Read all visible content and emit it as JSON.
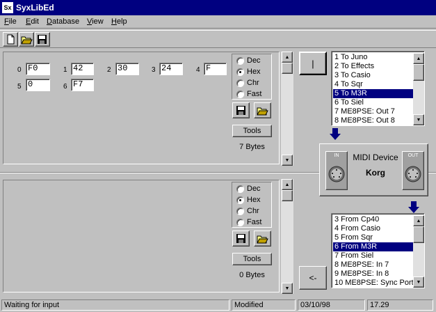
{
  "app": {
    "title": "SyxLibEd",
    "icon_text": "Sx"
  },
  "menu": [
    {
      "label": "File",
      "key": "F",
      "rest": "ile"
    },
    {
      "label": "Edit",
      "key": "E",
      "rest": "dit"
    },
    {
      "label": "Database",
      "key": "D",
      "rest": "atabase"
    },
    {
      "label": "View",
      "key": "V",
      "rest": "iew"
    },
    {
      "label": "Help",
      "key": "H",
      "rest": "elp"
    }
  ],
  "toolbar": {
    "icons": [
      "new-file-icon",
      "open-folder-icon",
      "save-disk-icon"
    ]
  },
  "top_pane": {
    "bytes": [
      {
        "index": "0",
        "value": "F0"
      },
      {
        "index": "1",
        "value": "42"
      },
      {
        "index": "2",
        "value": "30"
      },
      {
        "index": "3",
        "value": "24"
      },
      {
        "index": "4",
        "value": "F"
      },
      {
        "index": "5",
        "value": "0"
      },
      {
        "index": "6",
        "value": "F7"
      }
    ],
    "radios": [
      "Dec",
      "Hex",
      "Chr",
      "Fast"
    ],
    "selected_radio": "Hex",
    "tools_label": "Tools",
    "byte_count": "7 Bytes"
  },
  "bottom_pane": {
    "radios": [
      "Dec",
      "Hex",
      "Chr",
      "Fast"
    ],
    "selected_radio": "Hex",
    "tools_label": "Tools",
    "byte_count": "0 Bytes"
  },
  "send_button": {
    "label": "|"
  },
  "receive_button": {
    "label": "<-"
  },
  "output_list": {
    "items": [
      "1 To Juno",
      "2 To Effects",
      "3 To Casio",
      "4 To Sqr",
      "5 To M3R",
      "6 To Siel",
      "7 ME8PSE:  Out 7",
      "8 ME8PSE:  Out 8"
    ],
    "selected": "5 To M3R"
  },
  "midi_device": {
    "title": "MIDI Device",
    "name": "Korg",
    "in_label": "IN",
    "out_label": "OUT"
  },
  "input_list": {
    "items": [
      "3 From Cp40",
      "4 From Casio",
      "5 From Sqr",
      "6 From M3R",
      "7 From Siel",
      "8 ME8PSE:  In 7",
      "9 ME8PSE:  In 8",
      "10 ME8PSE: Sync Port"
    ],
    "selected": "6 From M3R"
  },
  "status": {
    "message": "Waiting for input",
    "state": "Modified",
    "date": "03/10/98",
    "time": "17.29"
  },
  "colors": {
    "titlebar": "#000080",
    "face": "#c0c0c0",
    "selection": "#000080",
    "arrow": "#000080"
  }
}
